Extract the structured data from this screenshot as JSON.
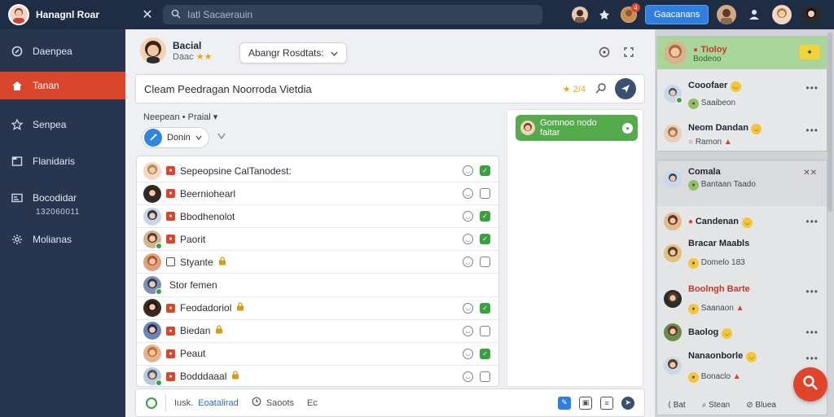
{
  "app": {
    "title": "Hanagnl Roar"
  },
  "colors": {
    "topbar": "#1f2d44",
    "sidebar": "#27354f",
    "accent": "#d9462b",
    "primary": "#2f7ee0",
    "success": "#3aa141",
    "highlight": "#a9d49a"
  },
  "topbar": {
    "search_placeholder": "Iatl Sacaerauin",
    "button_label": "Gaacanans",
    "notif_count": "4",
    "icons": [
      "close-icon",
      "search-icon",
      "pin-icon",
      "bell-icon",
      "user-icon"
    ]
  },
  "sidebar": {
    "items": [
      {
        "label": "Daenpea",
        "icon": "chat-icon"
      },
      {
        "label": "Tanan",
        "icon": "home-icon"
      },
      {
        "label": "Senpea",
        "icon": "star-icon"
      },
      {
        "label": "Flanidaris",
        "icon": "folder-icon"
      },
      {
        "label": "Bocodidar",
        "icon": "card-icon"
      },
      {
        "label": "Molianas",
        "icon": "gear-icon"
      }
    ],
    "sub_value": "132060011"
  },
  "profile": {
    "name": "Bacial",
    "sub": "Daac",
    "rating_stars": "★★"
  },
  "status_select": {
    "value": "Abangr Rosdtats:"
  },
  "query": {
    "text": "Cleam Peedragan Noorroda Vietdia",
    "rating": "★ 2/4"
  },
  "filter": {
    "label": "Neepean • Praial ▾",
    "chip": "Donin"
  },
  "contacts": [
    {
      "name": "Sepeopsine CalTanodest:",
      "tag": "red",
      "online": false,
      "lock": false,
      "check": true
    },
    {
      "name": "Beerniohearl",
      "tag": "red",
      "online": false,
      "lock": false,
      "check": false
    },
    {
      "name": "Bbodhenolot",
      "tag": "red",
      "online": false,
      "lock": false,
      "check": true
    },
    {
      "name": "Paorit",
      "tag": "red",
      "online": true,
      "lock": false,
      "check": true
    },
    {
      "name": "Styante",
      "tag": "outline",
      "online": false,
      "lock": true,
      "check": false
    },
    {
      "name": "Stor femen",
      "tag": "none",
      "online": true,
      "lock": false,
      "check": null
    },
    {
      "name": "Feodadoriol",
      "tag": "red",
      "online": false,
      "lock": true,
      "check": true
    },
    {
      "name": "Biedan",
      "tag": "red",
      "online": false,
      "lock": true,
      "check": false
    },
    {
      "name": "Peaut",
      "tag": "red",
      "online": false,
      "lock": false,
      "check": true
    },
    {
      "name": "Bodddaaal",
      "tag": "red",
      "online": true,
      "lock": true,
      "check": false
    }
  ],
  "chat": {
    "bubble_text": "Gomnoo nodo faitar"
  },
  "composer": {
    "item1": "Iusk.",
    "item1_b": "Eoatalirad",
    "item2": "Saoots",
    "item3": "Ec"
  },
  "right": {
    "card1": {
      "top": {
        "name": "Tioloy",
        "sub": "Bodeoo",
        "badge": "✦"
      },
      "items": [
        {
          "name": "Cooofaer",
          "sub": "Saaibeon"
        },
        {
          "name": "Neom Dandan",
          "sub": "Ramon"
        }
      ]
    },
    "card2": {
      "top": {
        "name": "Comala",
        "sub": "Bantaan Taado"
      },
      "items": [
        {
          "name": "Candenan",
          "sub": ""
        },
        {
          "name": "Bracar Maabls",
          "sub": "Domelo 183"
        },
        {
          "name": "Boolngh Barte",
          "sub": "Saanaon"
        },
        {
          "name": "Baolog",
          "sub": ""
        },
        {
          "name": "Nanaonborle",
          "sub": "Bonaclo"
        }
      ]
    },
    "bottom": {
      "item1": "Bat",
      "item2": "Stean",
      "item3": "Bluea"
    }
  }
}
